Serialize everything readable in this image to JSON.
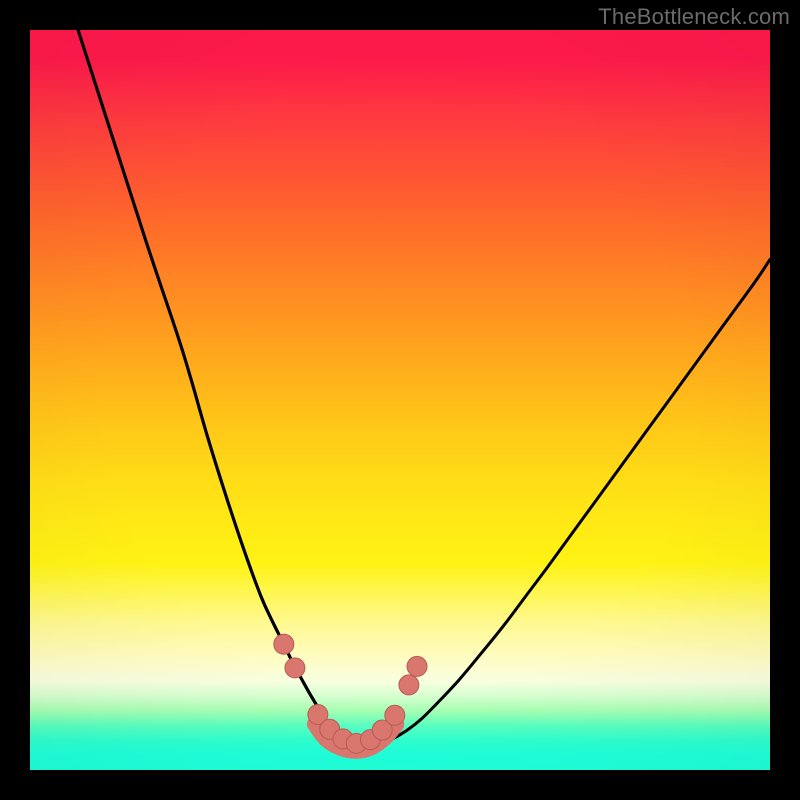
{
  "watermark": {
    "text": "TheBottleneck.com"
  },
  "colors": {
    "background": "#000000",
    "gradient_top": "#ff1a4b",
    "gradient_mid": "#ffe016",
    "gradient_bottom": "#1fffd8",
    "curve": "#000000",
    "marker_fill": "#d9766e",
    "marker_stroke": "#b85b54"
  },
  "chart_data": {
    "type": "line",
    "title": "",
    "xlabel": "",
    "ylabel": "",
    "xlim": [
      0,
      100
    ],
    "ylim": [
      0,
      100
    ],
    "grid": false,
    "legend": false,
    "note": "Values estimated from pixel positions; no axis ticks or labels are visible. y-axis is inverted relative to screen (0 at top).",
    "series": [
      {
        "name": "left-curve",
        "x": [
          6.5,
          15.5,
          20.5,
          24.0,
          26.5,
          29.0,
          31.2,
          32.8,
          34.3,
          35.5,
          36.7,
          37.7,
          38.7,
          39.6,
          40.5,
          41.4,
          42.3,
          43.2,
          44.1,
          45.0
        ],
        "y": [
          0.0,
          28.0,
          43.0,
          55.0,
          63.0,
          70.5,
          76.5,
          80.0,
          83.0,
          85.5,
          87.7,
          89.5,
          91.2,
          92.8,
          94.0,
          95.0,
          95.8,
          96.5,
          97.0,
          97.4
        ]
      },
      {
        "name": "right-curve",
        "x": [
          45.0,
          47.0,
          49.0,
          51.0,
          53.0,
          55.0,
          58.0,
          61.0,
          64.0,
          67.0,
          70.0,
          74.0,
          78.0,
          82.0,
          86.0,
          90.0,
          94.0,
          98.0,
          100.0
        ],
        "y": [
          97.4,
          96.8,
          95.8,
          94.6,
          93.0,
          91.0,
          87.8,
          84.2,
          80.5,
          76.5,
          72.5,
          67.0,
          61.5,
          56.0,
          50.5,
          45.0,
          39.5,
          34.0,
          31.0
        ]
      },
      {
        "name": "bottom-connector",
        "x": [
          38.5,
          40.0,
          42.0,
          44.0,
          46.0,
          48.0,
          49.5
        ],
        "y": [
          93.8,
          95.8,
          97.0,
          97.4,
          97.0,
          95.6,
          93.8
        ]
      }
    ],
    "markers": [
      {
        "x": 34.3,
        "y": 83.0,
        "r": 1.35,
        "on": "left-curve"
      },
      {
        "x": 35.8,
        "y": 86.2,
        "r": 1.35,
        "on": "left-curve"
      },
      {
        "x": 38.9,
        "y": 92.5,
        "r": 1.35,
        "on": "bottom-connector"
      },
      {
        "x": 40.5,
        "y": 94.5,
        "r": 1.35,
        "on": "bottom-connector"
      },
      {
        "x": 42.3,
        "y": 95.8,
        "r": 1.35,
        "on": "bottom-connector"
      },
      {
        "x": 44.1,
        "y": 96.4,
        "r": 1.35,
        "on": "bottom-connector"
      },
      {
        "x": 46.0,
        "y": 95.9,
        "r": 1.35,
        "on": "bottom-connector"
      },
      {
        "x": 47.6,
        "y": 94.6,
        "r": 1.35,
        "on": "bottom-connector"
      },
      {
        "x": 49.3,
        "y": 92.6,
        "r": 1.35,
        "on": "bottom-connector"
      },
      {
        "x": 51.2,
        "y": 88.5,
        "r": 1.35,
        "on": "right-curve"
      },
      {
        "x": 52.3,
        "y": 86.0,
        "r": 1.35,
        "on": "right-curve"
      }
    ]
  }
}
